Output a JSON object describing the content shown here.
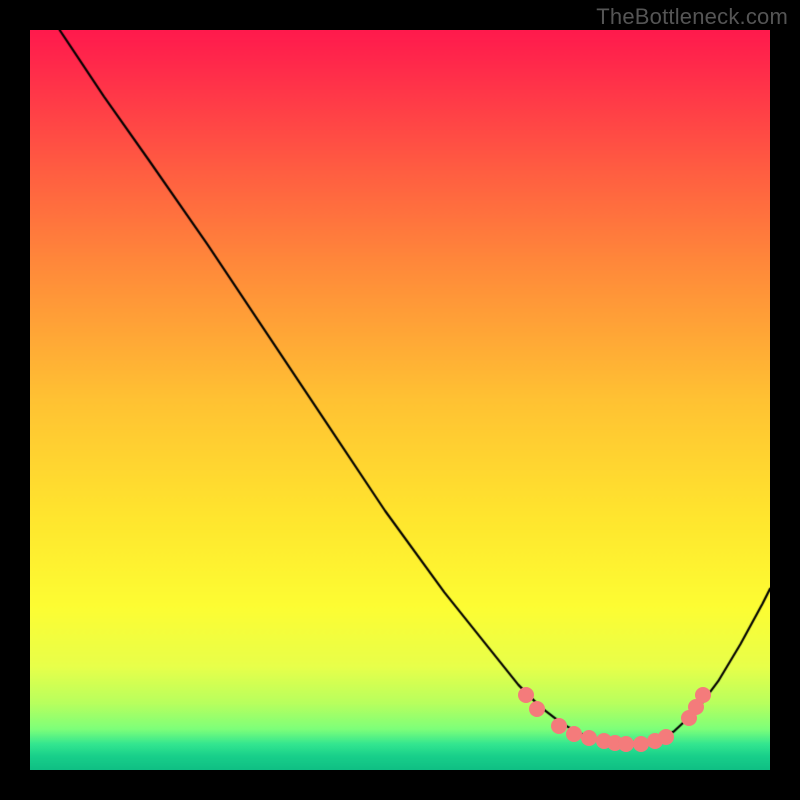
{
  "watermark": "TheBottleneck.com",
  "chart_data": {
    "type": "line",
    "title": "",
    "xlabel": "",
    "ylabel": "",
    "xlim": [
      0,
      100
    ],
    "ylim": [
      0,
      100
    ],
    "gradient_stops": [
      {
        "pos": 0.0,
        "color": "#ff1a4d"
      },
      {
        "pos": 0.06,
        "color": "#ff2e4a"
      },
      {
        "pos": 0.18,
        "color": "#ff5a42"
      },
      {
        "pos": 0.32,
        "color": "#ff8a3a"
      },
      {
        "pos": 0.5,
        "color": "#ffc233"
      },
      {
        "pos": 0.66,
        "color": "#ffe62e"
      },
      {
        "pos": 0.78,
        "color": "#fdfd33"
      },
      {
        "pos": 0.86,
        "color": "#e8ff4a"
      },
      {
        "pos": 0.91,
        "color": "#b8ff5e"
      },
      {
        "pos": 0.945,
        "color": "#7dff7a"
      },
      {
        "pos": 0.965,
        "color": "#33e690"
      },
      {
        "pos": 0.982,
        "color": "#18cf8a"
      },
      {
        "pos": 1.0,
        "color": "#0fbf84"
      }
    ],
    "curve": [
      {
        "x": 4.0,
        "y": 100.0
      },
      {
        "x": 6.0,
        "y": 97.0
      },
      {
        "x": 10.0,
        "y": 91.0
      },
      {
        "x": 16.0,
        "y": 82.5
      },
      {
        "x": 24.0,
        "y": 71.0
      },
      {
        "x": 32.0,
        "y": 59.0
      },
      {
        "x": 40.0,
        "y": 47.0
      },
      {
        "x": 48.0,
        "y": 35.0
      },
      {
        "x": 56.0,
        "y": 24.0
      },
      {
        "x": 62.0,
        "y": 16.5
      },
      {
        "x": 66.0,
        "y": 11.5
      },
      {
        "x": 69.0,
        "y": 8.5
      },
      {
        "x": 72.0,
        "y": 6.2
      },
      {
        "x": 75.0,
        "y": 4.6
      },
      {
        "x": 78.0,
        "y": 3.7
      },
      {
        "x": 81.0,
        "y": 3.4
      },
      {
        "x": 84.0,
        "y": 3.8
      },
      {
        "x": 87.0,
        "y": 5.2
      },
      {
        "x": 90.0,
        "y": 8.0
      },
      {
        "x": 93.0,
        "y": 12.0
      },
      {
        "x": 96.0,
        "y": 17.0
      },
      {
        "x": 99.0,
        "y": 22.5
      },
      {
        "x": 100.0,
        "y": 24.5
      }
    ],
    "dots": [
      {
        "x": 67.0,
        "y": 10.2
      },
      {
        "x": 68.5,
        "y": 8.3
      },
      {
        "x": 71.5,
        "y": 5.9
      },
      {
        "x": 73.5,
        "y": 4.9
      },
      {
        "x": 75.5,
        "y": 4.3
      },
      {
        "x": 77.5,
        "y": 3.9
      },
      {
        "x": 79.0,
        "y": 3.6
      },
      {
        "x": 80.5,
        "y": 3.45
      },
      {
        "x": 82.5,
        "y": 3.5
      },
      {
        "x": 84.5,
        "y": 3.9
      },
      {
        "x": 86.0,
        "y": 4.5
      },
      {
        "x": 89.0,
        "y": 7.0
      },
      {
        "x": 90.0,
        "y": 8.5
      },
      {
        "x": 91.0,
        "y": 10.2
      }
    ],
    "dot_color": "#f47b7b"
  }
}
